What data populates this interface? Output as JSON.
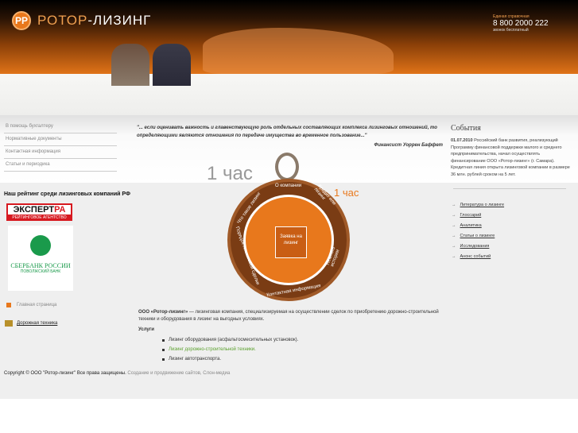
{
  "header": {
    "logo_mark": "РР",
    "logo_brand": "РОТОР",
    "logo_suffix": "-ЛИЗИНГ",
    "phone_caption": "Единая справочная",
    "phone": "8 800 2000 222",
    "phone_note": "звонок бесплатный"
  },
  "nav": [
    {
      "label": "В помощь бухгалтеру"
    },
    {
      "label": "Нормативные документы"
    },
    {
      "label": "Контактная информация"
    },
    {
      "label": "Статьи и периодика"
    }
  ],
  "quote": {
    "text": "\"... если оценивать важность и главенствующую роль отдельных составляющих комплекса лизинговых отношений, то определяющими являются отношения по передаче имущества во временное пользование...\"",
    "author": "Финансист Уоррен Баффет"
  },
  "events": {
    "title": "События",
    "date": "01.07.2010",
    "text": "Российский банк развития, реализующий Программу финансовой поддержки малого и среднего предпринимательства, начал осуществлять финансирование ООО «Ротор-лизинг» (г. Самара). Кредитная линия открыта лизинговой компании в размере 36 млн. рублей сроком на 5 лет."
  },
  "rating": {
    "title": "Наш рейтинг среди лизинговых компаний РФ",
    "expert_main": "ЭКСПЕРТ",
    "expert_ra": "РА",
    "expert_sub": "РЕЙТИНГОВОЕ АГЕНТСТВО",
    "sber_line1": "СБЕРБАНК РОССИИ",
    "sber_line2": "ПОВОЛЖСКИЙ БАНК"
  },
  "side_links": {
    "home": "Главная страница",
    "road": "Дорожная техника"
  },
  "dial": {
    "hour": "1 час",
    "center": "Заявка на лизинг",
    "items": [
      "О компании",
      "Кредит или лизинг",
      "Немного истории",
      "Контактная информация",
      "Порядок лизинговой сделки",
      "Что такое лизинг"
    ]
  },
  "intro": {
    "company": "ООО «Ротор-лизинг»",
    "text": " — лизинговая компания, специализируемая на осуществлении сделок по приобретению дорожно-строительной техники и оборудования в лизинг на выгодных условиях.",
    "services_title": "Услуги",
    "services": [
      "Лизинг оборудования (асфальтосмесительных установок).",
      "Лизинг дорожно-строительной техники.",
      "Лизинг автотранспорта."
    ]
  },
  "right_links": [
    "Литература о лизинге",
    "Глоссарий",
    "Аналитика",
    "Статьи о лизинге",
    "Исследования",
    "Анонс событий"
  ],
  "footer": {
    "prefix": "Copyright ©",
    "company": "ООО \"Ротор-лизинг\"",
    "rights": "Все права защищены.",
    "dev": "Создание и продвижение сайтов, Слон-медиа"
  },
  "colors": {
    "accent": "#e8781c",
    "green": "#5aa02c"
  }
}
